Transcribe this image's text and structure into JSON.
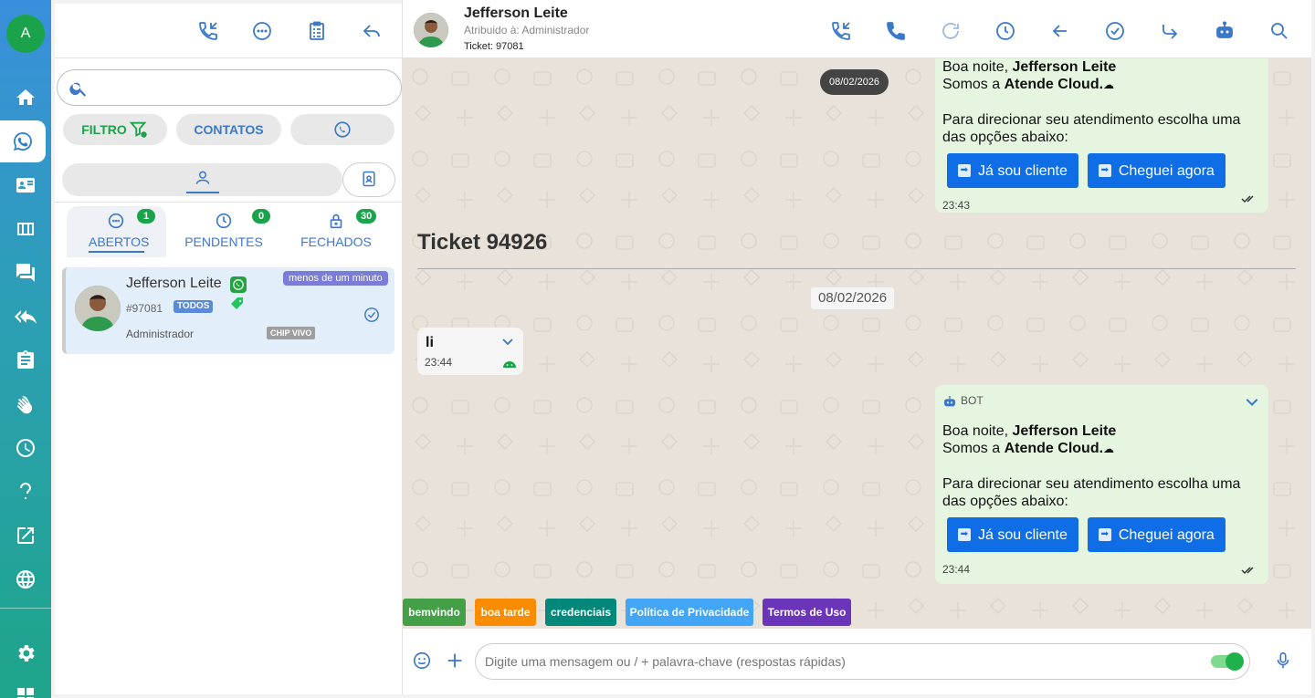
{
  "rail": {
    "avatar_letter": "A",
    "items": [
      "home",
      "whatsapp",
      "contacts",
      "kanban",
      "chats",
      "reply-all",
      "clipboard",
      "wave",
      "clock",
      "help",
      "external",
      "globe",
      "settings"
    ]
  },
  "panel": {
    "search_placeholder": "",
    "filter_label": "FILTRO",
    "contacts_label": "CONTATOS",
    "tabs": [
      {
        "label": "ABERTOS",
        "count": "1"
      },
      {
        "label": "PENDENTES",
        "count": "0"
      },
      {
        "label": "FECHADOS",
        "count": "30"
      }
    ],
    "ticket": {
      "name": "Jefferson Leite",
      "number": "#97081",
      "queue_tag": "TODOS",
      "assigned": "Administrador",
      "connection": "CHIP VIVO",
      "time": "menos de um minuto"
    }
  },
  "chat": {
    "contact_name": "Jefferson Leite",
    "assigned_to": "Atribuido à: Administrador",
    "ticket_label": "Ticket: 97081",
    "date_top": "08/02/2026",
    "ticket_title": "Ticket 94926",
    "date_divider": "08/02/2026",
    "msg_top": {
      "line1_a": "Boa noite, ",
      "line1_b": "Jefferson Leite",
      "line2_a": "Somos a ",
      "line2_b": "Atende Cloud.",
      "line3": "Para direcionar seu atendimento escolha uma das opções abaixo:",
      "btn1": "Já sou cliente",
      "btn2": "Cheguei agora",
      "time": "23:43"
    },
    "msg_in": {
      "text": "li",
      "time": "23:44"
    },
    "msg_bot": {
      "sender": "BOT",
      "line1_a": "Boa noite, ",
      "line1_b": "Jefferson Leite",
      "line2_a": "Somos a ",
      "line2_b": "Atende Cloud.",
      "line3": "Para direcionar seu atendimento escolha uma das opções abaixo:",
      "btn1": "Já sou cliente",
      "btn2": "Cheguei agora",
      "time": "23:44"
    },
    "quick_replies": [
      {
        "label": "bemvindo",
        "color": "#43a047"
      },
      {
        "label": "boa tarde",
        "color": "#fb8c00"
      },
      {
        "label": "credenciais",
        "color": "#00897b"
      },
      {
        "label": "Política de Privacidade",
        "color": "#42a5f5"
      },
      {
        "label": "Termos de Uso",
        "color": "#6a35b8"
      }
    ],
    "composer_placeholder": "Digite uma mensagem ou / + palavra-chave (respostas rápidas)"
  }
}
